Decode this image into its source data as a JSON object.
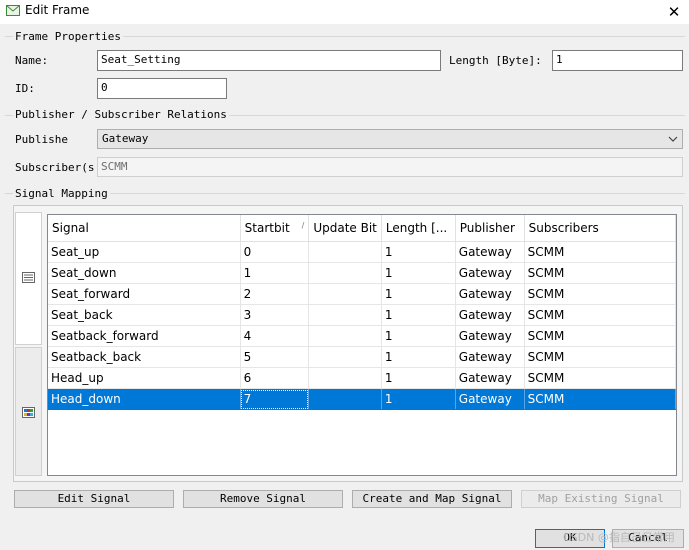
{
  "window": {
    "title": "Edit Frame",
    "close_glyph": "✕",
    "icon": "envelope-icon"
  },
  "frame_properties": {
    "group_title": "Frame Properties",
    "name_label": "Name:",
    "name_value": "Seat_Setting",
    "length_label": "Length [Byte]:",
    "length_value": "1",
    "id_label": "ID:",
    "id_value": "0"
  },
  "relations": {
    "group_title": "Publisher / Subscriber Relations",
    "publisher_label": "Publishe",
    "publisher_value": "Gateway",
    "subscriber_label": "Subscriber(s",
    "subscriber_value": "SCMM"
  },
  "signal_mapping": {
    "group_title": "Signal Mapping",
    "side_tabs": [
      {
        "icon": "list-view-icon"
      },
      {
        "icon": "color-grid-icon"
      }
    ],
    "columns": [
      "Signal",
      "Startbit",
      "Update Bit",
      "Length [...",
      "Publisher",
      "Subscribers"
    ],
    "sort_glyph": "/",
    "rows": [
      {
        "signal": "Seat_up",
        "startbit": "0",
        "update_bit": "",
        "length": "1",
        "publisher": "Gateway",
        "subscribers": "SCMM"
      },
      {
        "signal": "Seat_down",
        "startbit": "1",
        "update_bit": "",
        "length": "1",
        "publisher": "Gateway",
        "subscribers": "SCMM"
      },
      {
        "signal": "Seat_forward",
        "startbit": "2",
        "update_bit": "",
        "length": "1",
        "publisher": "Gateway",
        "subscribers": "SCMM"
      },
      {
        "signal": "Seat_back",
        "startbit": "3",
        "update_bit": "",
        "length": "1",
        "publisher": "Gateway",
        "subscribers": "SCMM"
      },
      {
        "signal": "Seatback_forward",
        "startbit": "4",
        "update_bit": "",
        "length": "1",
        "publisher": "Gateway",
        "subscribers": "SCMM"
      },
      {
        "signal": "Seatback_back",
        "startbit": "5",
        "update_bit": "",
        "length": "1",
        "publisher": "Gateway",
        "subscribers": "SCMM"
      },
      {
        "signal": "Head_up",
        "startbit": "6",
        "update_bit": "",
        "length": "1",
        "publisher": "Gateway",
        "subscribers": "SCMM"
      },
      {
        "signal": "Head_down",
        "startbit": "7",
        "update_bit": "",
        "length": "1",
        "publisher": "Gateway",
        "subscribers": "SCMM",
        "selected": true
      }
    ],
    "selection_color": "#0078d7"
  },
  "actions": {
    "edit_signal": "Edit Signal",
    "remove_signal": "Remove Signal",
    "create_and_map": "Create and Map Signal",
    "map_existing": "Map Existing Signal"
  },
  "footer": {
    "ok": "OK",
    "cancel": "Cancel",
    "watermark": "CSDN @指自己日常用"
  }
}
